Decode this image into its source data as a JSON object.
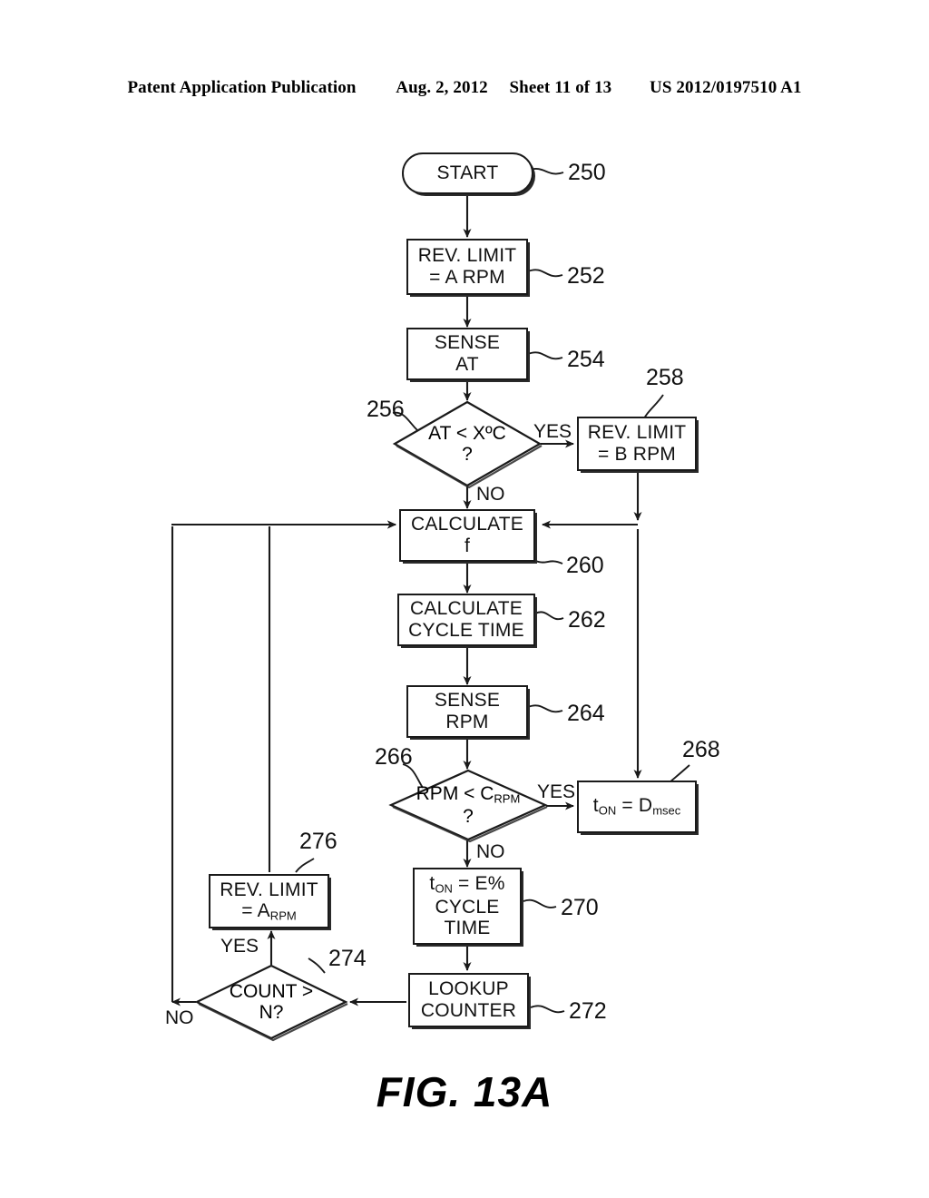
{
  "header": {
    "publication": "Patent Application Publication",
    "date": "Aug. 2, 2012",
    "sheet": "Sheet 11 of 13",
    "docnum": "US 2012/0197510 A1"
  },
  "figure": {
    "caption": "FIG. 13A"
  },
  "nodes": {
    "start": {
      "ref": "250",
      "text": "START"
    },
    "rev_limit_a": {
      "ref": "252",
      "line1": "REV. LIMIT",
      "line2": "= A RPM"
    },
    "sense_at": {
      "ref": "254",
      "line1": "SENSE",
      "line2": "AT"
    },
    "at_check": {
      "ref": "256",
      "line1": "AT < XºC",
      "line2": "?"
    },
    "rev_limit_b": {
      "ref": "258",
      "line1": "REV. LIMIT",
      "line2": "= B RPM"
    },
    "calc_f": {
      "ref": "260",
      "line1": "CALCULATE",
      "line2": "f"
    },
    "calc_cycle": {
      "ref": "262",
      "line1": "CALCULATE",
      "line2": "CYCLE TIME"
    },
    "sense_rpm": {
      "ref": "264",
      "line1": "SENSE",
      "line2": "RPM"
    },
    "rpm_check": {
      "ref": "266",
      "line1": "RPM < C",
      "sub1": "RPM",
      "line2": "?"
    },
    "ton_d": {
      "ref": "268",
      "pre": "t",
      "sub_on": "ON",
      "mid": " = D",
      "sub_msec": "msec"
    },
    "ton_e": {
      "ref": "270",
      "pre": "t",
      "sub_on": "ON",
      "mid": " = E%",
      "line2": "CYCLE",
      "line3": "TIME"
    },
    "lookup": {
      "ref": "272",
      "line1": "LOOKUP",
      "line2": "COUNTER"
    },
    "count_check": {
      "ref": "274",
      "line1": "COUNT >",
      "line2": "N?"
    },
    "rev_limit_a2": {
      "ref": "276",
      "line1": "REV. LIMIT",
      "pre2": "= A",
      "sub2": "RPM"
    }
  },
  "edge_labels": {
    "at_yes": "YES",
    "at_no": "NO",
    "rpm_yes": "YES",
    "rpm_no": "NO",
    "count_yes": "YES",
    "count_no": "NO"
  },
  "colors": {
    "ink": "#1a1a1a",
    "paper": "#ffffff"
  }
}
